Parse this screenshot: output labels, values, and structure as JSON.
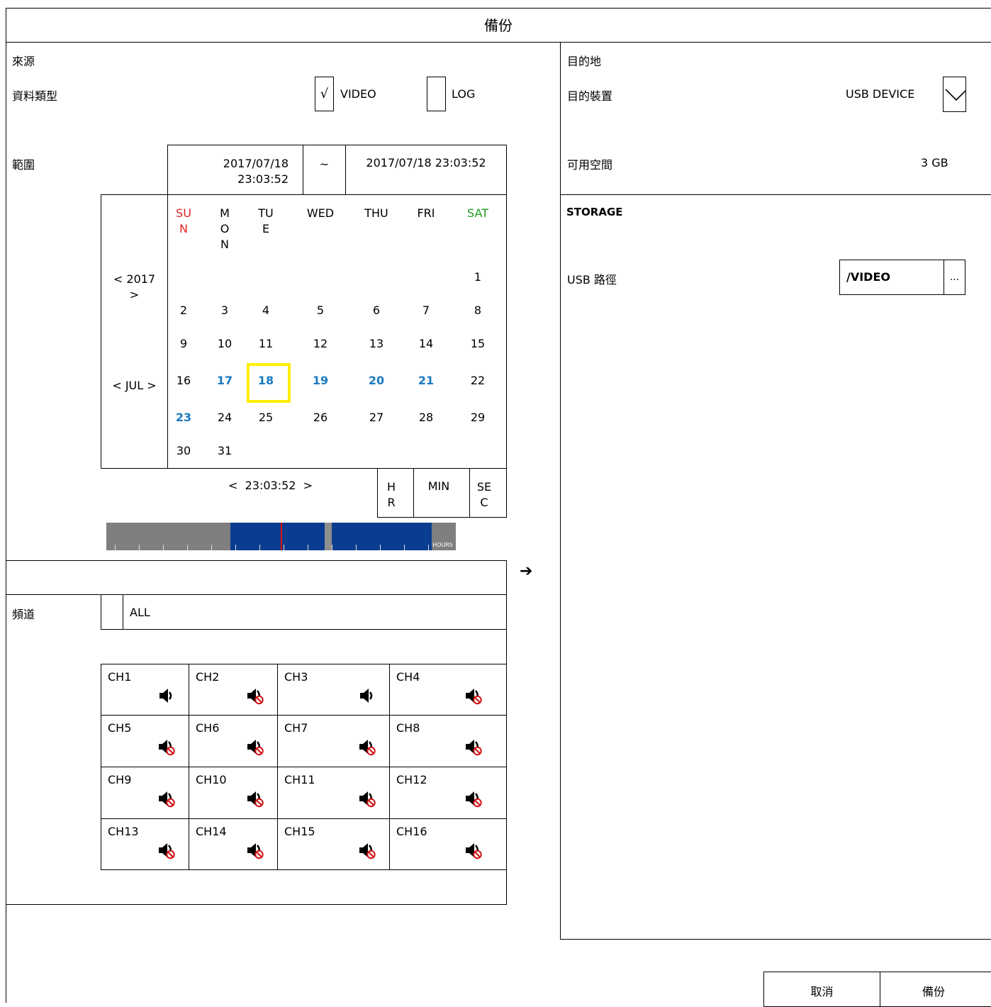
{
  "title": "備份",
  "source": {
    "heading": "來源",
    "data_type_label": "資料類型",
    "video_check": "√",
    "video_label": "VIDEO",
    "log_check": "",
    "log_label": "LOG",
    "range_label": "範圍",
    "range_start": "2017/07/18\n23:03:52",
    "range_sep": "~",
    "range_end": "2017/07/18 23:03:52"
  },
  "calendar": {
    "year_nav": "< 2017\n>",
    "month_nav": "< JUL >",
    "weekdays": [
      "SU\nN",
      "M\nO\nN",
      "TU\nE",
      "WED",
      "THU",
      "FRI",
      "SAT"
    ],
    "weekday_colors": [
      "#e02020",
      "#000",
      "#000",
      "#000",
      "#000",
      "#000",
      "#1a9a1a"
    ],
    "weeks": [
      [
        "",
        "",
        "",
        "",
        "",
        "",
        "1"
      ],
      [
        "2",
        "3",
        "4",
        "5",
        "6",
        "7",
        "8"
      ],
      [
        "9",
        "10",
        "11",
        "12",
        "13",
        "14",
        "15"
      ],
      [
        "16",
        "17",
        "18",
        "19",
        "20",
        "21",
        "22"
      ],
      [
        "23",
        "24",
        "25",
        "26",
        "27",
        "28",
        "29"
      ],
      [
        "30",
        "31",
        "",
        "",
        "",
        "",
        ""
      ]
    ],
    "recorded_days": [
      "17",
      "18",
      "19",
      "20",
      "21",
      "23"
    ],
    "selected_day": "18",
    "recorded_color": "#1a7ac0",
    "selected_color": "#ffee00"
  },
  "time": {
    "value": "<  23:03:52  >",
    "hr": "H\nR",
    "min": "MIN",
    "sec": "SE\nC"
  },
  "timeline": {
    "hours_label": "HOURS"
  },
  "arrow": "➔",
  "channels": {
    "label": "頻道",
    "all_label": "ALL",
    "items": [
      {
        "name": "CH1",
        "audio": "speaker-on"
      },
      {
        "name": "CH2",
        "audio": "speaker-muted"
      },
      {
        "name": "CH3",
        "audio": "speaker-on"
      },
      {
        "name": "CH4",
        "audio": "speaker-muted"
      },
      {
        "name": "CH5",
        "audio": "speaker-muted"
      },
      {
        "name": "CH6",
        "audio": "speaker-muted"
      },
      {
        "name": "CH7",
        "audio": "speaker-muted"
      },
      {
        "name": "CH8",
        "audio": "speaker-muted"
      },
      {
        "name": "CH9",
        "audio": "speaker-muted"
      },
      {
        "name": "CH10",
        "audio": "speaker-muted"
      },
      {
        "name": "CH11",
        "audio": "speaker-muted"
      },
      {
        "name": "CH12",
        "audio": "speaker-muted"
      },
      {
        "name": "CH13",
        "audio": "speaker-muted"
      },
      {
        "name": "CH14",
        "audio": "speaker-muted"
      },
      {
        "name": "CH15",
        "audio": "speaker-muted"
      },
      {
        "name": "CH16",
        "audio": "speaker-muted"
      }
    ]
  },
  "destination": {
    "heading": "目的地",
    "device_label": "目的裝置",
    "device_value": "USB DEVICE",
    "space_label": "可用空間",
    "space_value": "3 GB",
    "storage_heading": "STORAGE",
    "usb_path_label": "USB 路徑",
    "usb_path_value": "/VIDEO",
    "browse_label": "..."
  },
  "buttons": {
    "cancel": "取消",
    "backup": "備份"
  }
}
